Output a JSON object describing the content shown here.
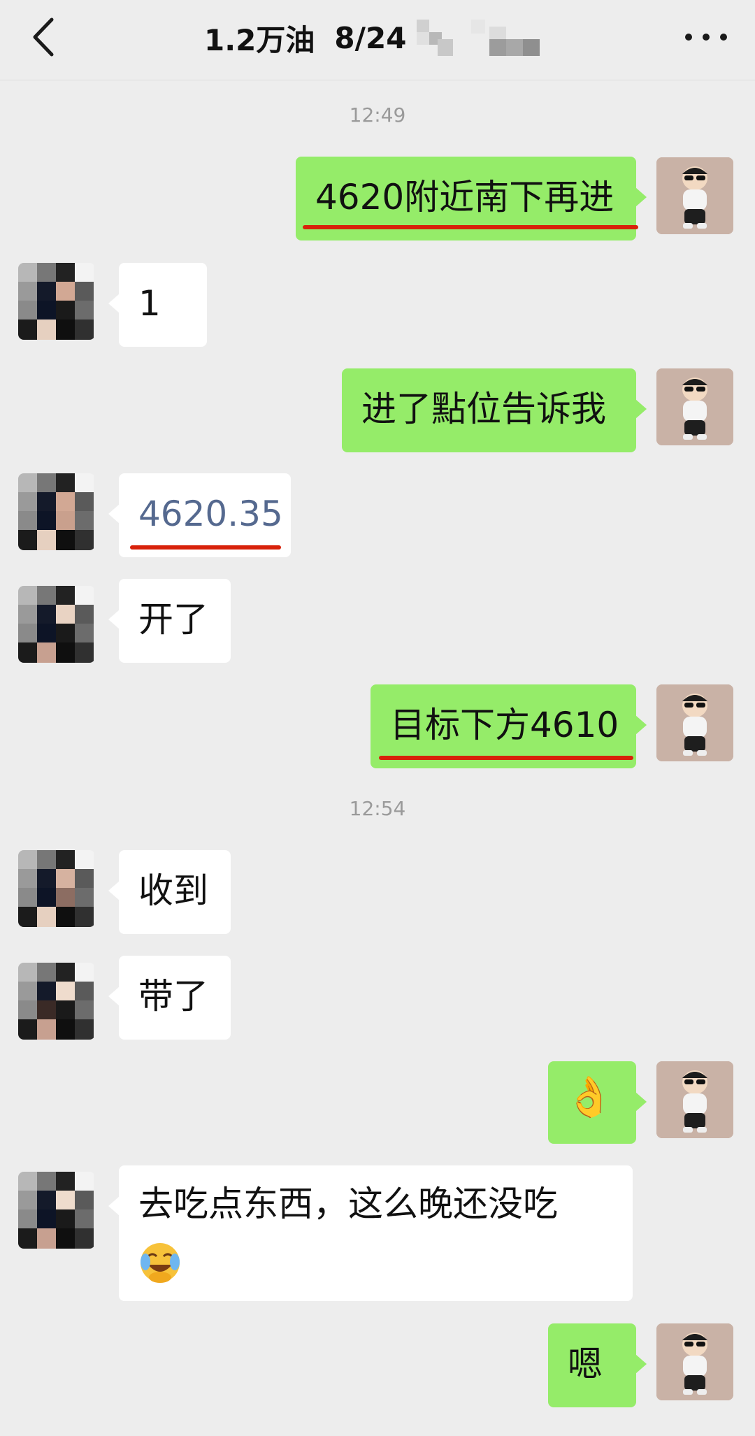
{
  "header": {
    "back_icon": "chevron-left-icon",
    "title": "1.2万油",
    "date": "8/24",
    "more_icon": "more-dots-icon"
  },
  "timestamps": [
    "12:49",
    "12:54"
  ],
  "messages": [
    {
      "from": "me",
      "text": "4620附近南下再进",
      "underlined": true
    },
    {
      "from": "other",
      "text": "1"
    },
    {
      "from": "me",
      "text": "进了點位告诉我"
    },
    {
      "from": "other",
      "text": "4620.35",
      "link": true,
      "underlined": true
    },
    {
      "from": "other",
      "text": "开了"
    },
    {
      "from": "me",
      "text": "目标下方4610",
      "underlined": true
    },
    {
      "from": "other",
      "text": "收到"
    },
    {
      "from": "other",
      "text": "带了"
    },
    {
      "from": "me",
      "text": "👌",
      "emoji": "ok-hand"
    },
    {
      "from": "other",
      "text": "去吃点东西，这么晚还没吃",
      "emoji": "crying-laughing"
    },
    {
      "from": "me",
      "text": "嗯"
    }
  ],
  "colors": {
    "background": "#ededed",
    "my_bubble": "#95ec69",
    "their_bubble": "#ffffff",
    "underline": "#d8210a",
    "link_text": "#55698f"
  }
}
